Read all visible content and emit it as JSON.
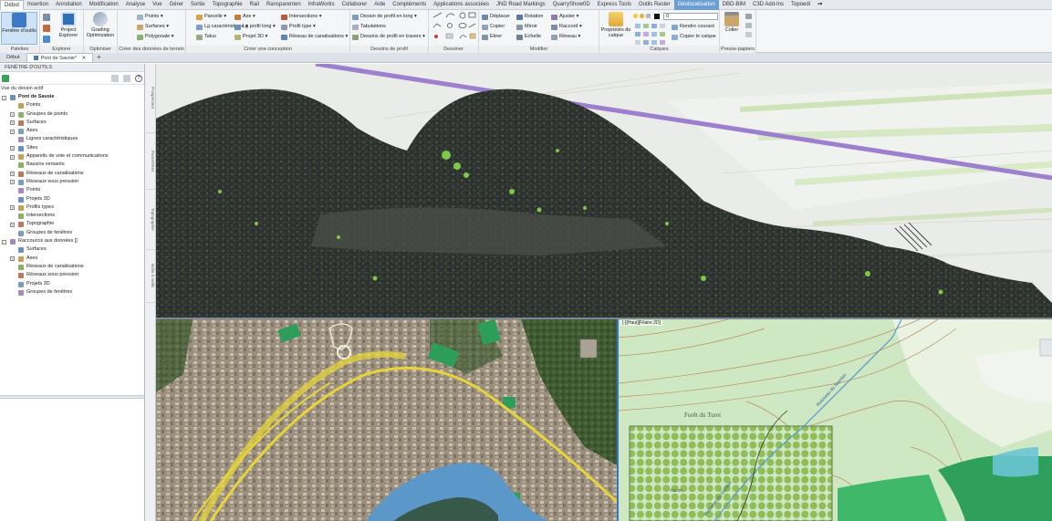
{
  "ribbon_tabs": [
    "Début",
    "Insertion",
    "Annotation",
    "Modification",
    "Analyse",
    "Vue",
    "Gérer",
    "Sortie",
    "Topographie",
    "Rail",
    "Ransparenten",
    "InfraWorks",
    "Collaborer",
    "Aide",
    "Compléments",
    "Applications associées",
    "JND Road Markings",
    "QuarryShow0D",
    "Express Tools",
    "Outils Raster",
    "Géolocalisation",
    "DBD-BIM",
    "C3D Add-Ins",
    "Topoedi"
  ],
  "ribbon": {
    "palettes": {
      "title": "Palettes",
      "fenetre_outils": "Fenêtre d'outils"
    },
    "explorer": {
      "title": "Explorer",
      "project_explorer": "Project Explorer"
    },
    "optimiser": {
      "title": "Optimiser",
      "grading_optimization": "Grading Optimization"
    },
    "donnees_terrain": {
      "title": "Créer des données de terrain",
      "points": "Points",
      "surfaces": "Surfaces",
      "polygonale": "Polygonale"
    },
    "conception": {
      "title": "Créer une conception",
      "parcelle": "Parcelle",
      "lig_caract": "Lg caractéristique",
      "talus": "Talus",
      "axe": "Axe",
      "lig_profil": "Lg profil long",
      "projet3d": "Projet 3D",
      "intersections": "Intersections",
      "profil_type": "Profil type",
      "reseau_canalisations": "Réseau de canalisations"
    },
    "dessins_profil": {
      "title": "Dessins de profil",
      "profil_long": "Dessin de profil en long",
      "tabulations": "Tabulations",
      "profil_travers": "Dessins de profil en travers"
    },
    "dessiner": {
      "title": "Dessiner"
    },
    "modifier": {
      "title": "Modifier",
      "deplacer": "Déplacer",
      "rotation": "Rotation",
      "ajuster": "Ajuster",
      "copier": "Copier",
      "miroir": "Miroir",
      "raccord": "Raccord",
      "etirer": "Etirer",
      "echelle": "Echelle",
      "reseau": "Réseau"
    },
    "calques": {
      "title": "Calques",
      "proprietes_calque": "Propriétés du calque",
      "current_layer": "0",
      "rendre_courant": "Rendre courant",
      "copier_calque": "Copier le calque"
    },
    "presse_papiers": {
      "title": "Presse-papiers",
      "coller": "Coller"
    }
  },
  "file_tabs": [
    "Début",
    "Pont de Savoie*"
  ],
  "toolspace": {
    "title": "FENÊTRE D'OUTILS",
    "active_view": "Vue du dessin actif",
    "side_tabs": [
      "Prospecteur",
      "Paramètres",
      "Topographie",
      "Boîte à outils"
    ],
    "tree": [
      {
        "label": "Pont de Savoie",
        "level": 0,
        "bold": true,
        "expander": "-"
      },
      {
        "label": "Points",
        "level": 1,
        "expander": ""
      },
      {
        "label": "Groupes de points",
        "level": 1,
        "expander": "+"
      },
      {
        "label": "Surfaces",
        "level": 1,
        "expander": "+"
      },
      {
        "label": "Axes",
        "level": 1,
        "expander": "+"
      },
      {
        "label": "Lignes caractéristiques",
        "level": 1,
        "expander": ""
      },
      {
        "label": "Sites",
        "level": 1,
        "expander": "+"
      },
      {
        "label": "Appareils de voie et communications",
        "level": 1,
        "expander": "+"
      },
      {
        "label": "Bassins versants",
        "level": 1,
        "expander": ""
      },
      {
        "label": "Réseaux de canalisations",
        "level": 1,
        "expander": "+"
      },
      {
        "label": "Réseaux sous pression",
        "level": 1,
        "expander": "+"
      },
      {
        "label": "Points",
        "level": 1,
        "expander": ""
      },
      {
        "label": "Projets 3D",
        "level": 1,
        "expander": ""
      },
      {
        "label": "Profils types",
        "level": 1,
        "expander": "+"
      },
      {
        "label": "Intersections",
        "level": 1,
        "expander": ""
      },
      {
        "label": "Topographie",
        "level": 1,
        "expander": "+"
      },
      {
        "label": "Groupes de fenêtres",
        "level": 1,
        "expander": ""
      },
      {
        "label": "Raccourcis aux données []",
        "level": 0,
        "expander": "-"
      },
      {
        "label": "Surfaces",
        "level": 1,
        "expander": ""
      },
      {
        "label": "Axes",
        "level": 1,
        "expander": "+"
      },
      {
        "label": "Réseaux de canalisations",
        "level": 1,
        "expander": ""
      },
      {
        "label": "Réseaux sous pression",
        "level": 1,
        "expander": ""
      },
      {
        "label": "Projets 3D",
        "level": 1,
        "expander": ""
      },
      {
        "label": "Groupes de fenêtres",
        "level": 1,
        "expander": ""
      }
    ]
  },
  "viewports": {
    "topo_label": "[-][Haut][Filaire 2D]",
    "topo_place_name": "Forêt du Turet",
    "river_label_1": "Ruisseau du Nambin",
    "river_label_2": "Ruisseau du Nambin",
    "contour_label": "750.00"
  },
  "colors": {
    "ribbon_active_tab": "#6b9fd4",
    "layer_line": "#9d7fd0",
    "vegetation": "#7ec84a",
    "water": "#5b97c9",
    "topo_green": "#3fb86a"
  }
}
